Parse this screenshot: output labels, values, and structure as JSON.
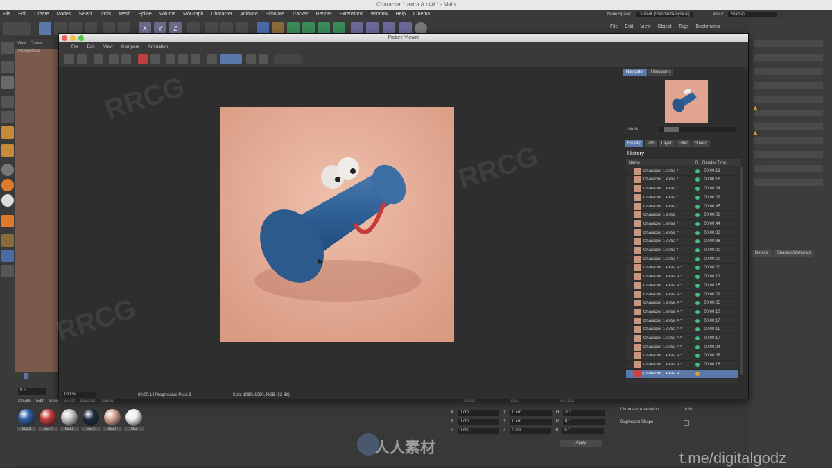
{
  "app": {
    "window_title": "Character 1 extra A.c4d * - Main",
    "menu": [
      "File",
      "Edit",
      "Create",
      "Modes",
      "Select",
      "Tools",
      "Mesh",
      "Spline",
      "Volume",
      "MoGraph",
      "Character",
      "Animate",
      "Simulate",
      "Tracker",
      "Render",
      "Extensions",
      "Window",
      "Help",
      "Cinema"
    ],
    "node_space_label": "Node Space:",
    "node_space_value": "Current (Standard/Physical)",
    "layout_label": "Layout:",
    "layout_value": "Startup",
    "om_menu": [
      "File",
      "Edit",
      "View",
      "Object",
      "Tags",
      "Bookmarks"
    ],
    "viewport_menu": [
      "View",
      "Came"
    ],
    "viewport_label": "Perspective",
    "frame_value": "0 F",
    "material_menu": [
      "Create",
      "Edit",
      "View",
      "Select",
      "Material",
      "Texture"
    ],
    "materials": [
      {
        "name": "Mat.3",
        "color": "#2e5fa3"
      },
      {
        "name": "Mat.2",
        "color": "#c43b3b"
      },
      {
        "name": "Mat.2",
        "color": "#c8c8c8"
      },
      {
        "name": "Mat.2",
        "color": "#1f2a44"
      },
      {
        "name": "Mat.1",
        "color": "#d7a695"
      },
      {
        "name": "Mat",
        "color": "#f0f0f0"
      }
    ],
    "coord_headers": [
      "Position",
      "Size",
      "Rotation"
    ],
    "coord_rows": [
      {
        "axis": "X",
        "pos": "0 cm",
        "size": "0 cm",
        "rot_axis": "H",
        "rot": "0 °"
      },
      {
        "axis": "Y",
        "pos": "0 cm",
        "size": "0 cm",
        "rot_axis": "P",
        "rot": "0 °"
      },
      {
        "axis": "Z",
        "pos": "0 cm",
        "size": "0 cm",
        "rot_axis": "B",
        "rot": "0 °"
      }
    ],
    "apply_label": "Apply",
    "attr_rows": [
      {
        "label": "Chromatic Aberration",
        "value": "0 %"
      },
      {
        "label": "Diaphragm Shape",
        "value": ""
      }
    ],
    "attr_tabs": [
      "Details",
      "Shaders/Materials"
    ],
    "watermark_bottom": "t.me/digitalgodz",
    "watermark_logo": "人人素材"
  },
  "picture_viewer": {
    "title": "Picture Viewer",
    "menu": [
      "File",
      "Edit",
      "View",
      "Compare",
      "Animation"
    ],
    "zoom": "100 %",
    "status_time": "00:00:14 Progressive Pass 3",
    "status_size": "Size: 1080x1080, RGB (32 Bit)",
    "nav_tabs": [
      "Navigator",
      "Histogram"
    ],
    "nav_zoom": "100 %",
    "info_tabs": [
      "History",
      "Info",
      "Layer",
      "Filter",
      "Stereo"
    ],
    "history_label": "History",
    "history_cols": [
      "Name",
      "R",
      "Render Time"
    ],
    "history": [
      {
        "name": "Character 1 extra *",
        "time": "00:00:13"
      },
      {
        "name": "Character 1 extra *",
        "time": "00:00:16"
      },
      {
        "name": "Character 1 extra *",
        "time": "00:00:24"
      },
      {
        "name": "Character 1 extra *",
        "time": "00:00:09"
      },
      {
        "name": "Character 1 extra *",
        "time": "00:00:45"
      },
      {
        "name": "Character 1 extra",
        "time": "00:00:06"
      },
      {
        "name": "Character 1 extra *",
        "time": "00:00:44"
      },
      {
        "name": "Character 1 extra *",
        "time": "00:00:33"
      },
      {
        "name": "Character 1 extra *",
        "time": "00:00:36"
      },
      {
        "name": "Character 1 extra *",
        "time": "00:00:00"
      },
      {
        "name": "Character 1 extra *",
        "time": "00:00:00"
      },
      {
        "name": "Character 1 extra A *",
        "time": "00:00:00"
      },
      {
        "name": "Character 1 extra A *",
        "time": "00:00:12"
      },
      {
        "name": "Character 1 extra A *",
        "time": "00:00:15"
      },
      {
        "name": "Character 1 extra A *",
        "time": "00:00:09"
      },
      {
        "name": "Character 1 extra A *",
        "time": "00:00:05"
      },
      {
        "name": "Character 1 extra A *",
        "time": "00:00:10"
      },
      {
        "name": "Character 1 extra A *",
        "time": "00:00:17"
      },
      {
        "name": "Character 1 extra A *",
        "time": "00:00:11"
      },
      {
        "name": "Character 1 extra A *",
        "time": "00:00:17"
      },
      {
        "name": "Character 1 extra A *",
        "time": "00:00:24"
      },
      {
        "name": "Character 1 extra A *",
        "time": "00:00:08"
      },
      {
        "name": "Character 1 extra A *",
        "time": "00:00:18"
      },
      {
        "name": "Character 1 extra A",
        "time": ""
      }
    ]
  }
}
